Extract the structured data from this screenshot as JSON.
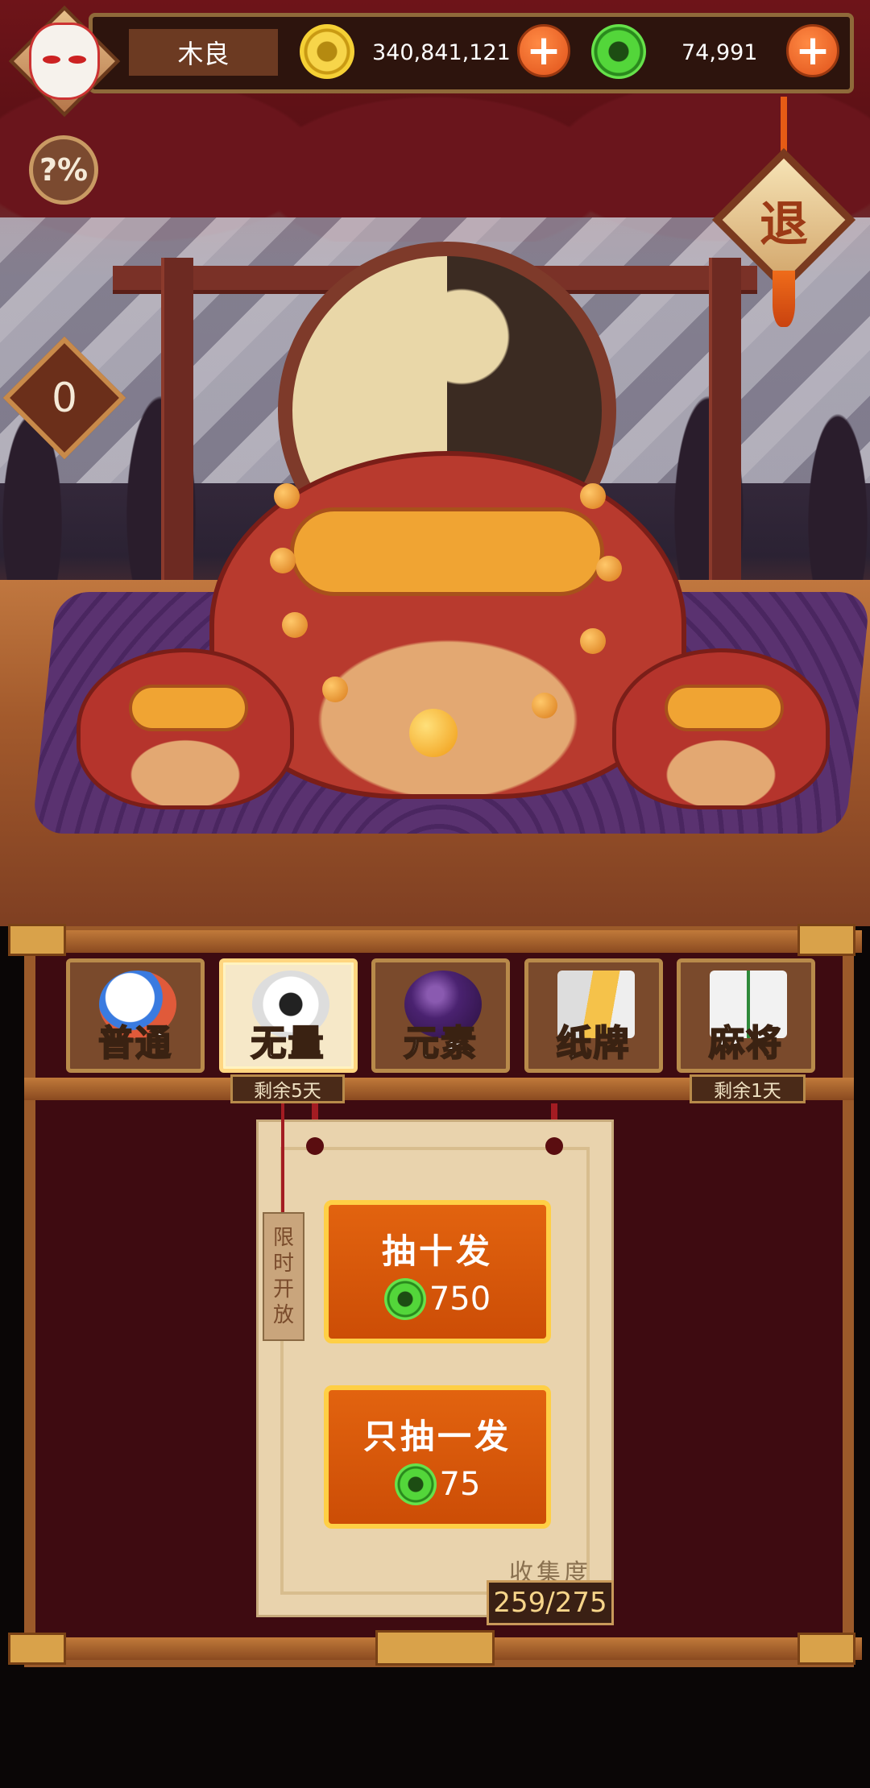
{
  "header": {
    "player_name": "木良",
    "gold_amount": "340,841,121",
    "jade_amount": "74,991",
    "add_gold_label": "+",
    "add_jade_label": "+"
  },
  "controls": {
    "help_label": "?%",
    "exit_label": "退",
    "counter_value": "0"
  },
  "tabs": [
    {
      "label": "普通",
      "selected": false
    },
    {
      "label": "无量",
      "selected": true,
      "remaining": "剩余5天"
    },
    {
      "label": "元素",
      "selected": false
    },
    {
      "label": "纸牌",
      "selected": false
    },
    {
      "label": "麻将",
      "selected": false,
      "remaining": "剩余1天"
    }
  ],
  "draw_panel": {
    "limited_tag": [
      "限",
      "时",
      "开",
      "放"
    ],
    "ten_pull": {
      "label": "抽十发",
      "cost": "750"
    },
    "single_pull": {
      "label": "只抽一发",
      "cost": "75"
    },
    "collection_label": "收集度",
    "collection_value": "259/275"
  },
  "colors": {
    "accent_orange": "#e2630f",
    "button_border": "#ffcf45",
    "panel_bg": "#3e0b11",
    "frame_wood": "#9b5a2a"
  }
}
